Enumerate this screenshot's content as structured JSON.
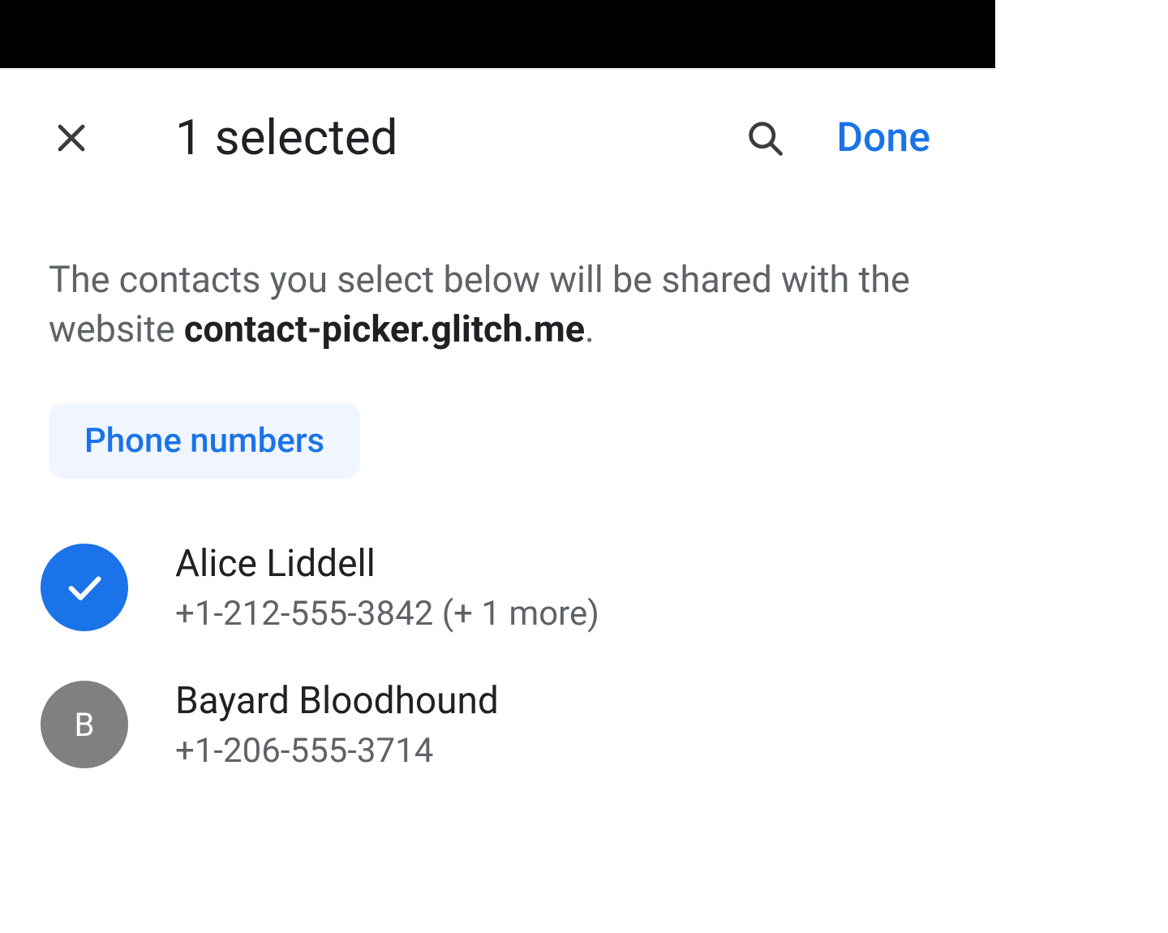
{
  "header": {
    "title": "1 selected",
    "done_label": "Done"
  },
  "description": {
    "prefix": "The contacts you select below will be shared with the website ",
    "website": "contact-picker.glitch.me",
    "suffix": "."
  },
  "chip": {
    "label": "Phone numbers"
  },
  "contacts": [
    {
      "selected": true,
      "avatar_letter": "",
      "name": "Alice Liddell",
      "detail": "+1-212-555-3842 (+ 1 more)"
    },
    {
      "selected": false,
      "avatar_letter": "B",
      "name": "Bayard Bloodhound",
      "detail": "+1-206-555-3714"
    }
  ]
}
